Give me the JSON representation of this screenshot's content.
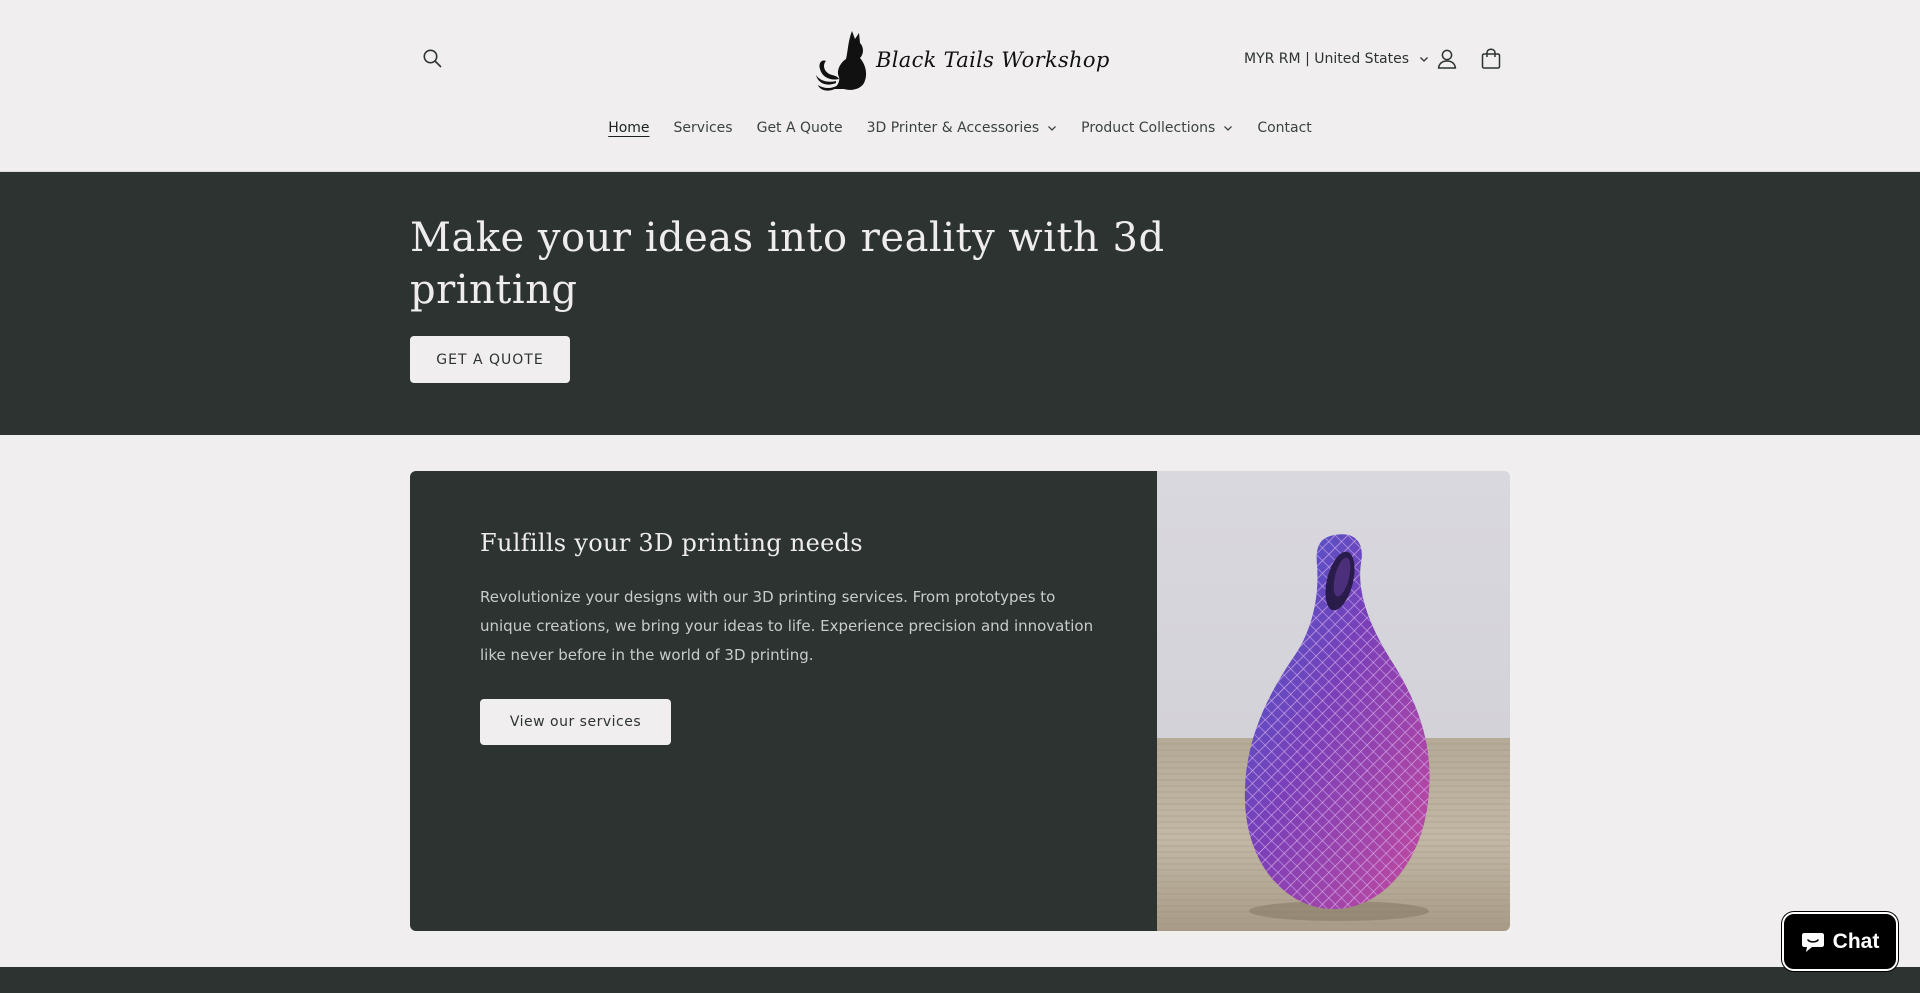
{
  "header": {
    "logo_text": "Black Tails Workshop",
    "currency_label": "MYR RM | United States"
  },
  "nav": {
    "items": [
      {
        "label": "Home",
        "active": true,
        "dropdown": false
      },
      {
        "label": "Services",
        "active": false,
        "dropdown": false
      },
      {
        "label": "Get A Quote",
        "active": false,
        "dropdown": false
      },
      {
        "label": "3D Printer & Accessories",
        "active": false,
        "dropdown": true
      },
      {
        "label": "Product Collections",
        "active": false,
        "dropdown": true
      },
      {
        "label": "Contact",
        "active": false,
        "dropdown": false
      }
    ]
  },
  "hero": {
    "title": "Make your ideas into reality with 3d printing",
    "button_label": "GET A QUOTE"
  },
  "feature": {
    "title": "Fulfills your 3D printing needs",
    "description": "Revolutionize your designs with our 3D printing services. From prototypes to unique creations, we bring your ideas to life. Experience precision and innovation like never before in the world of 3D printing.",
    "button_label": "View our services"
  },
  "chat": {
    "label": "Chat"
  },
  "colors": {
    "background": "#f0eeee",
    "dark": "#2c3330",
    "button_light": "#f0eeee"
  }
}
